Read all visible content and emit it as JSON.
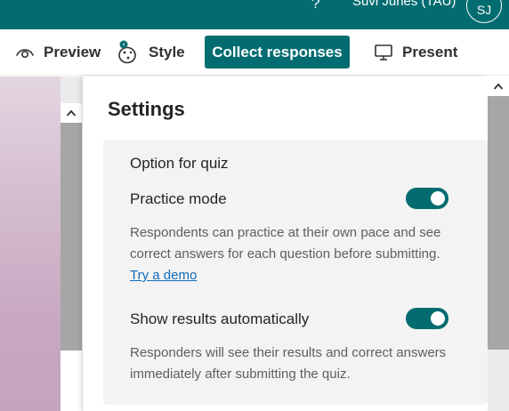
{
  "header": {
    "help_glyph": "?",
    "user_name": "Suvi Junes (TAU)",
    "avatar_initials": "SJ",
    "bar_color": "#036c70"
  },
  "toolbar": {
    "preview_label": "Preview",
    "style_label": "Style",
    "collect_label": "Collect responses",
    "present_label": "Present",
    "more_glyph": "···",
    "accent": "#036c70"
  },
  "settings": {
    "title": "Settings",
    "section_title": "Option for quiz",
    "practice_mode": {
      "label": "Practice mode",
      "description": "Respondents can practice at their own pace and see correct answers for each question before submitting.",
      "link_text": "Try a demo",
      "enabled": true
    },
    "show_results": {
      "label": "Show results automatically",
      "description": "Responders will see their results and correct answers immediately after submitting the quiz.",
      "enabled": true
    }
  },
  "icons": {
    "preview": "eye-icon",
    "style": "palette-icon",
    "present": "monitor-icon",
    "more": "more-horizontal-icon",
    "scroll_up": "chevron-up-icon"
  }
}
